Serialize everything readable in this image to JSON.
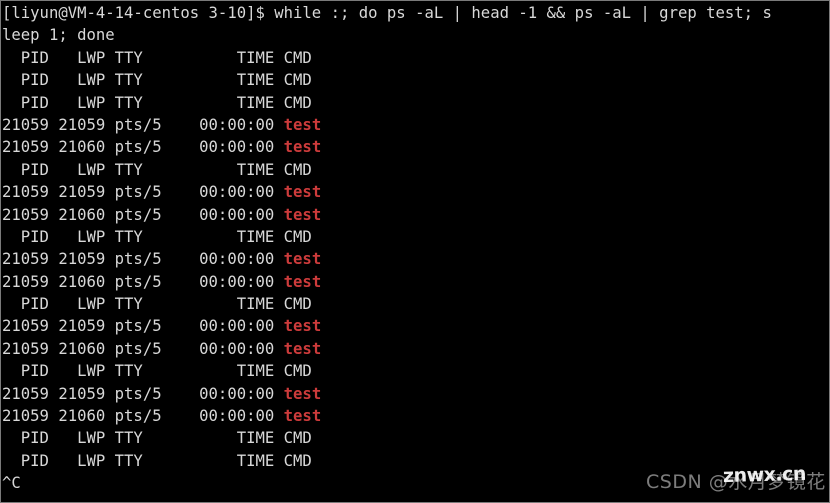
{
  "terminal": {
    "shell_prompt": "[liyun@VM-4-14-centos 3-10]$ ",
    "command": "while :; do ps -aL | head -1 && ps -aL | grep test; sleep 1; done",
    "command_wrap_head": "[liyun@VM-4-14-centos 3-10]$ while :; do ps -aL | head -1 && ps -aL | grep test; s",
    "command_wrap_tail": "leep 1; done",
    "interrupt_marker": "^C",
    "header_line": "  PID   LWP TTY          TIME CMD",
    "colors": {
      "background": "#000000",
      "foreground": "#d8d8d8",
      "red": "#cc3b3b",
      "border": "#7a7a7a"
    },
    "lines": [
      {
        "id": 0,
        "type": "prompt",
        "text": "[liyun@VM-4-14-centos 3-10]$ while :; do ps -aL | head -1 && ps -aL | grep test; s"
      },
      {
        "id": 1,
        "type": "prompt",
        "text": "leep 1; done"
      },
      {
        "id": 2,
        "type": "header",
        "text": "  PID   LWP TTY          TIME CMD"
      },
      {
        "id": 3,
        "type": "header",
        "text": "  PID   LWP TTY          TIME CMD"
      },
      {
        "id": 4,
        "type": "header",
        "text": "  PID   LWP TTY          TIME CMD"
      },
      {
        "id": 5,
        "type": "process",
        "prefix": "21059 21059 pts/5    00:00:00 ",
        "cmd": "test"
      },
      {
        "id": 6,
        "type": "process",
        "prefix": "21059 21060 pts/5    00:00:00 ",
        "cmd": "test"
      },
      {
        "id": 7,
        "type": "header",
        "text": "  PID   LWP TTY          TIME CMD"
      },
      {
        "id": 8,
        "type": "process",
        "prefix": "21059 21059 pts/5    00:00:00 ",
        "cmd": "test"
      },
      {
        "id": 9,
        "type": "process",
        "prefix": "21059 21060 pts/5    00:00:00 ",
        "cmd": "test"
      },
      {
        "id": 10,
        "type": "header",
        "text": "  PID   LWP TTY          TIME CMD"
      },
      {
        "id": 11,
        "type": "process",
        "prefix": "21059 21059 pts/5    00:00:00 ",
        "cmd": "test"
      },
      {
        "id": 12,
        "type": "process",
        "prefix": "21059 21060 pts/5    00:00:00 ",
        "cmd": "test"
      },
      {
        "id": 13,
        "type": "header",
        "text": "  PID   LWP TTY          TIME CMD"
      },
      {
        "id": 14,
        "type": "process",
        "prefix": "21059 21059 pts/5    00:00:00 ",
        "cmd": "test"
      },
      {
        "id": 15,
        "type": "process",
        "prefix": "21059 21060 pts/5    00:00:00 ",
        "cmd": "test"
      },
      {
        "id": 16,
        "type": "header",
        "text": "  PID   LWP TTY          TIME CMD"
      },
      {
        "id": 17,
        "type": "process",
        "prefix": "21059 21059 pts/5    00:00:00 ",
        "cmd": "test"
      },
      {
        "id": 18,
        "type": "process",
        "prefix": "21059 21060 pts/5    00:00:00 ",
        "cmd": "test"
      },
      {
        "id": 19,
        "type": "header",
        "text": "  PID   LWP TTY          TIME CMD"
      },
      {
        "id": 20,
        "type": "header",
        "text": "  PID   LWP TTY          TIME CMD"
      },
      {
        "id": 21,
        "type": "interrupt",
        "text": "^C"
      }
    ]
  },
  "watermarks": {
    "csdn": "CSDN @水月梦镜花",
    "site": "znwx.cn"
  }
}
